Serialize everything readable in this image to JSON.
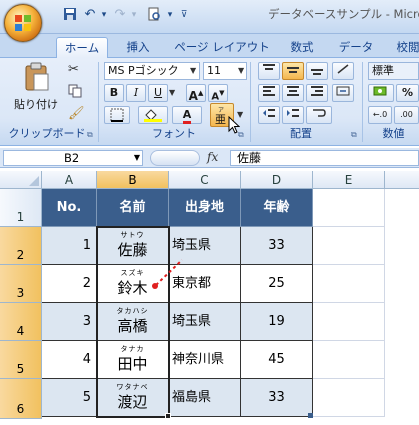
{
  "window": {
    "title": "データベースサンプル - Micro",
    "qa_icons": [
      "save-icon",
      "undo-icon",
      "redo-icon",
      "print-preview-icon",
      "customize-icon"
    ]
  },
  "tabs": [
    "ホーム",
    "挿入",
    "ページ レイアウト",
    "数式",
    "データ",
    "校閲"
  ],
  "ribbon": {
    "clipboard": {
      "paste_label": "貼り付け",
      "group_label": "クリップボード"
    },
    "font": {
      "font_name": "MS Pゴシック",
      "font_size": "11",
      "bold": "B",
      "italic": "I",
      "underline": "U",
      "grow": "A",
      "shrink": "A",
      "color_a": "A",
      "group_label": "フォント"
    },
    "alignment": {
      "group_label": "配置"
    },
    "number": {
      "format": "標準",
      "group_label": "数値"
    }
  },
  "formula_bar": {
    "cell_ref": "B2",
    "fx": "fx",
    "content": "佐藤"
  },
  "columns": [
    "A",
    "B",
    "C",
    "D",
    "E"
  ],
  "rows": [
    "1",
    "2",
    "3",
    "4",
    "5",
    "6"
  ],
  "table": {
    "headers": [
      "No.",
      "名前",
      "出身地",
      "年齢"
    ],
    "records": [
      {
        "no": "1",
        "name": "佐藤",
        "furigana": "サトウ",
        "origin": "埼玉県",
        "age": "33"
      },
      {
        "no": "2",
        "name": "鈴木",
        "furigana": "スズキ",
        "origin": "東京都",
        "age": "25"
      },
      {
        "no": "3",
        "name": "高橋",
        "furigana": "タカハシ",
        "origin": "埼玉県",
        "age": "19"
      },
      {
        "no": "4",
        "name": "田中",
        "furigana": "タナカ",
        "origin": "神奈川県",
        "age": "45"
      },
      {
        "no": "5",
        "name": "渡辺",
        "furigana": "ワタナベ",
        "origin": "福島県",
        "age": "33"
      }
    ]
  },
  "colors": {
    "header_bg": "#3a5e8c",
    "cell_bg": "#dce6f1",
    "selection_orange": "#f1c15f",
    "annotation_red": "#e02020"
  }
}
